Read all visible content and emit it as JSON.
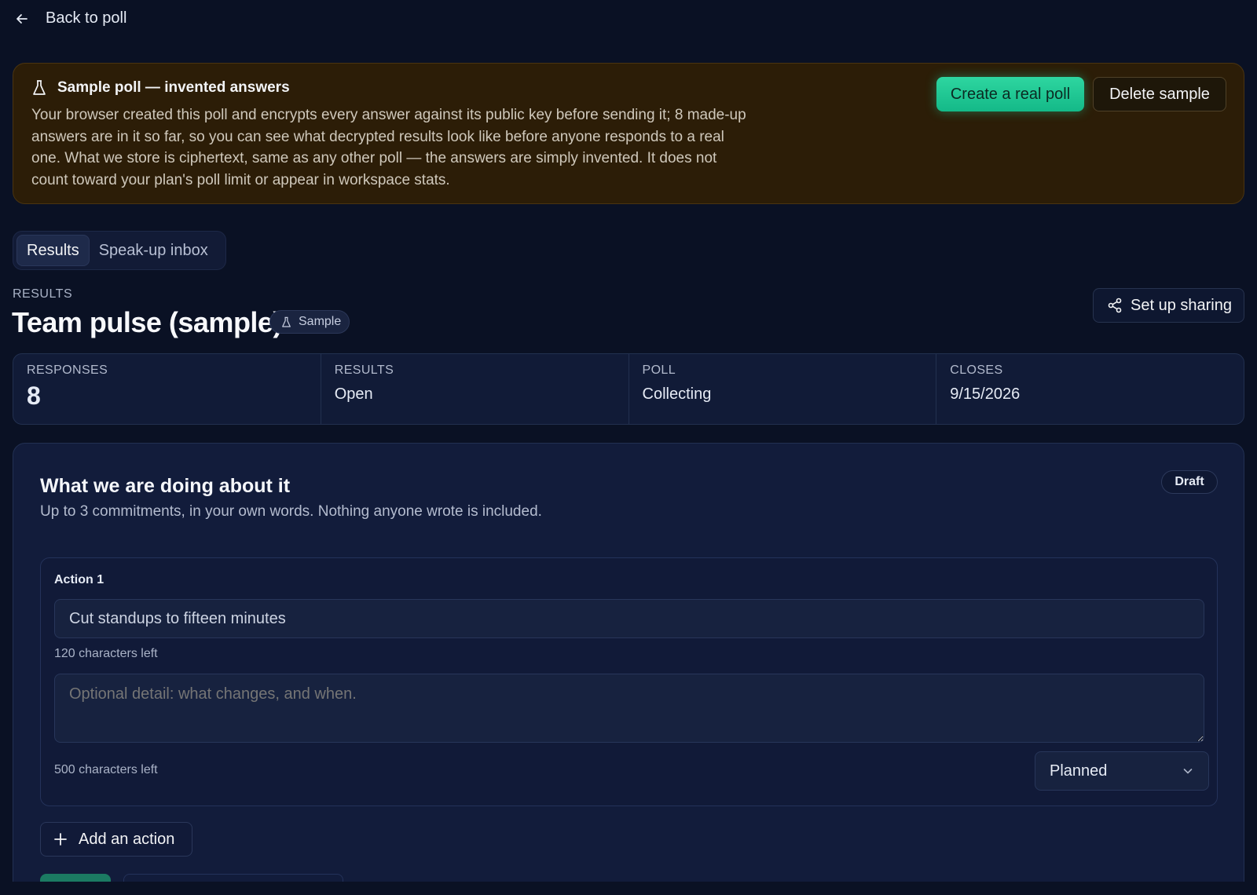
{
  "nav": {
    "back_label": "Back to poll"
  },
  "banner": {
    "title": "Sample poll — invented answers",
    "body": "Your browser created this poll and encrypts every answer against its public key before sending it; 8 made-up answers are in it so far, so you can see what decrypted results look like before anyone responds to a real one. What we store is ciphertext, same as any other poll — the answers are simply invented. It does not count toward your plan's poll limit or appear in workspace stats.",
    "create_label": "Create a real poll",
    "delete_label": "Delete sample",
    "background": "#2c1d07",
    "accent": "#14b988"
  },
  "tabs": [
    {
      "label": "Results",
      "active": true
    },
    {
      "label": "Speak-up inbox",
      "active": false
    }
  ],
  "header": {
    "eyebrow": "RESULTS",
    "title": "Team pulse (sample)",
    "badge": "Sample",
    "share_label": "Set up sharing"
  },
  "stats": [
    {
      "label": "RESPONSES",
      "value": "8"
    },
    {
      "label": "RESULTS",
      "value": "Open"
    },
    {
      "label": "POLL",
      "value": "Collecting"
    },
    {
      "label": "CLOSES",
      "value": "9/15/2026"
    }
  ],
  "commitments": {
    "title": "What we are doing about it",
    "subtitle": "Up to 3 commitments, in your own words. Nothing anyone wrote is included.",
    "status_badge": "Draft",
    "actions": [
      {
        "label": "Action 1",
        "value": "Cut standups to fifteen minutes",
        "value_chars_left": "120 characters left",
        "detail_placeholder": "Optional detail: what changes, and when.",
        "detail_chars_left": "500 characters left",
        "status": "Planned"
      }
    ],
    "add_label": "Add an action"
  },
  "icons": {
    "back": "arrow-left-icon",
    "flask": "flask-icon",
    "share": "share-icon",
    "chevron": "chevron-down-icon",
    "plus": "plus-icon"
  }
}
